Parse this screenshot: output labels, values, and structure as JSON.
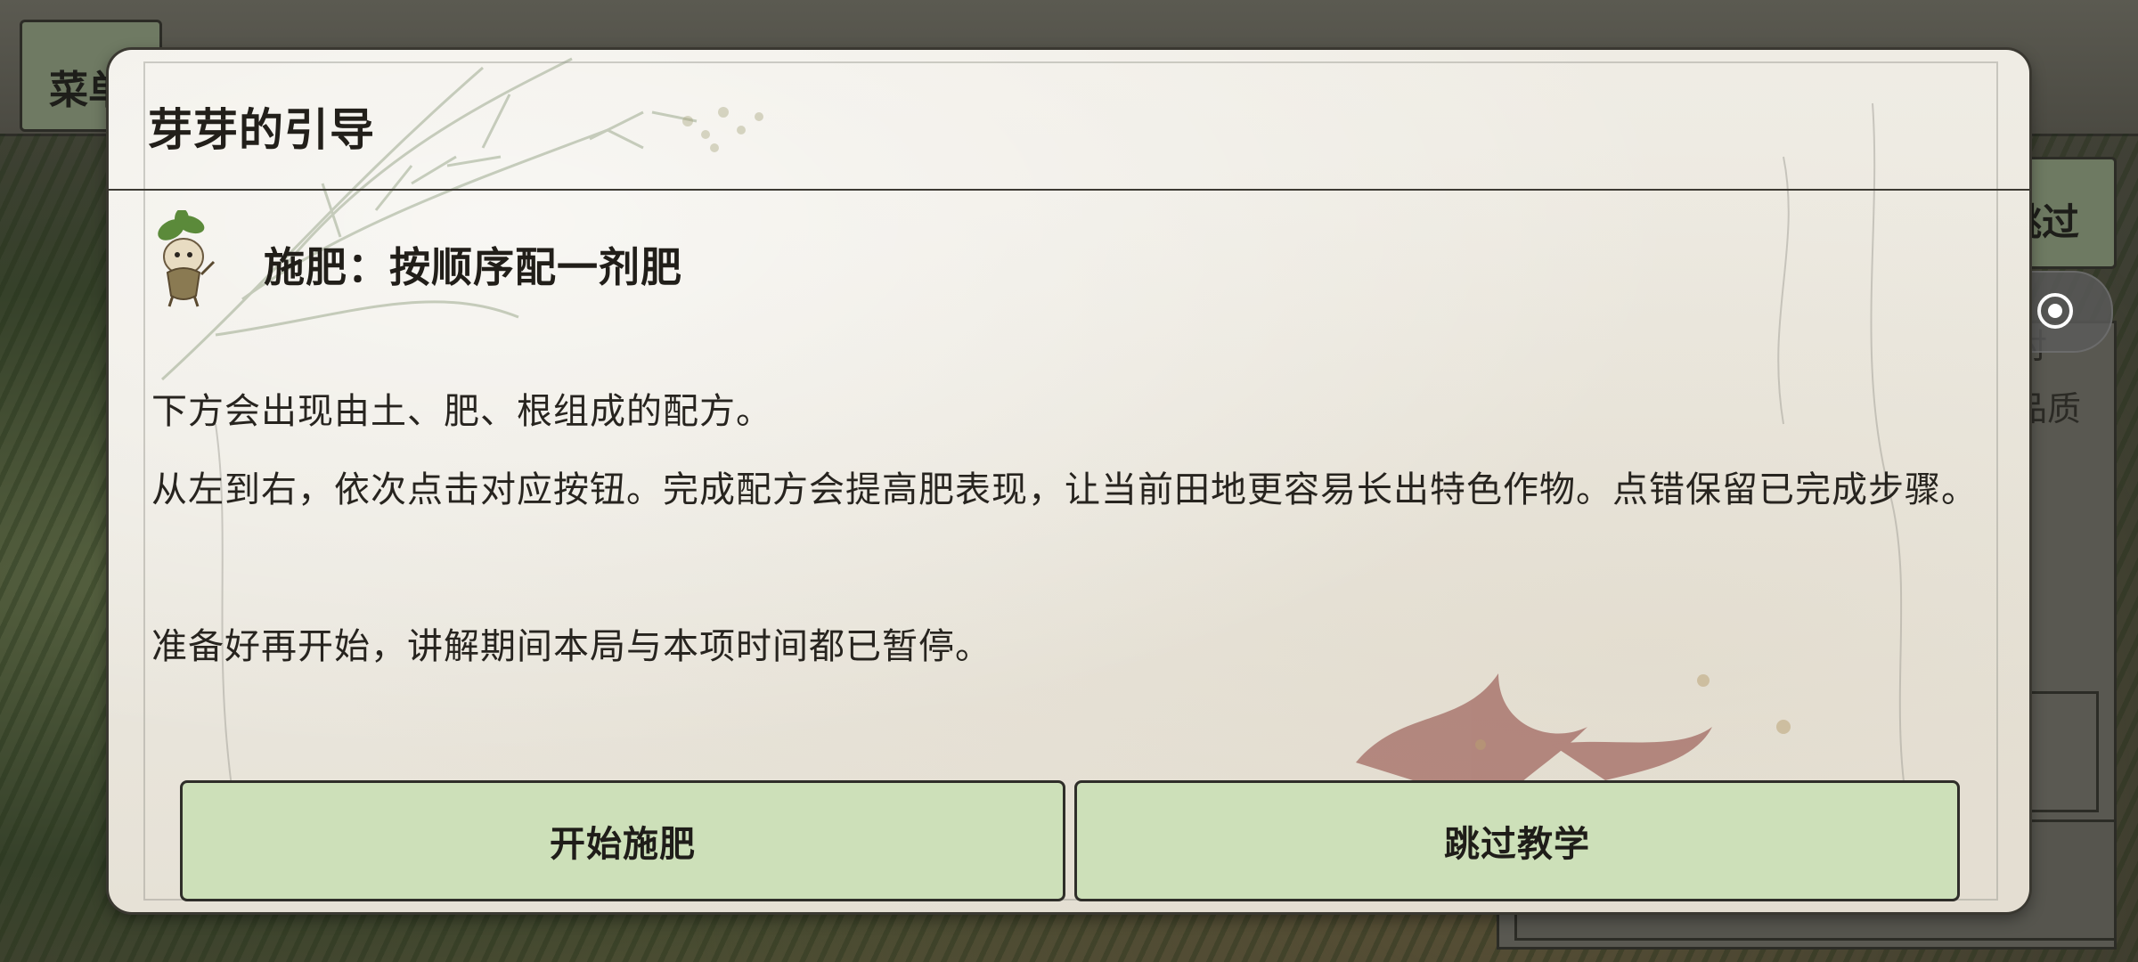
{
  "background": {
    "menu_label": "菜单",
    "side_skip_label": "跳过",
    "side_text_1": "对",
    "side_text_2": "品质"
  },
  "capsule": {
    "more_icon": "more-dots-icon",
    "close_icon": "target-close-icon"
  },
  "dialog": {
    "title": "芽芽的引导",
    "step_title": "施肥：按顺序配一剂肥",
    "paragraphs": [
      "下方会出现由土、肥、根组成的配方。",
      "从左到右，依次点击对应按钮。完成配方会提高肥表现，让当前田地更容易长出特色作物。点错保留已完成步骤。",
      "准备好再开始，讲解期间本局与本项时间都已暂停。"
    ],
    "start_button": "开始施肥",
    "skip_button": "跳过教学"
  },
  "colors": {
    "button_bg": "#cde0b9",
    "paper_bg": "#ece9e1",
    "text": "#221f1a"
  }
}
